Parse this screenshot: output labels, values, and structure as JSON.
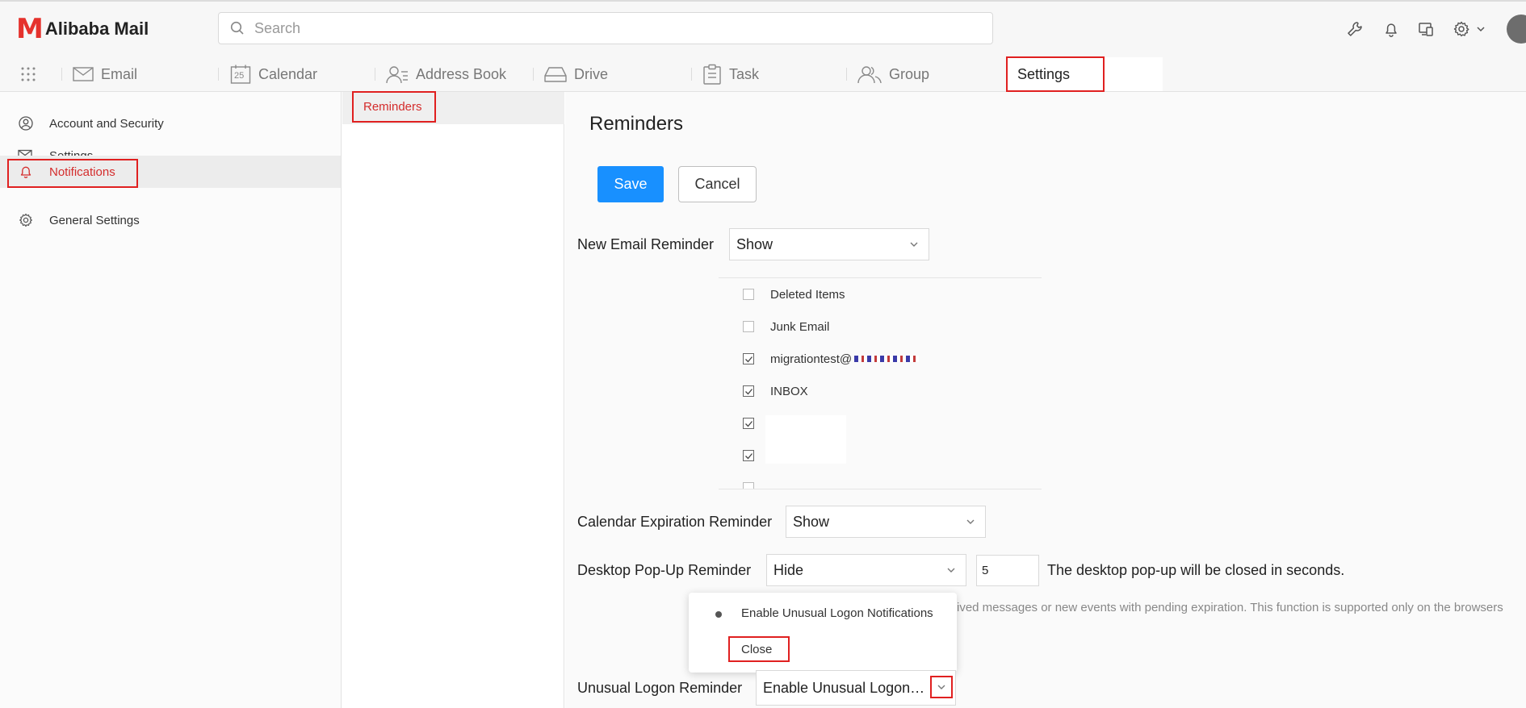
{
  "app": {
    "logo_mark": "M",
    "logo_text": "Alibaba Mail"
  },
  "search": {
    "placeholder": "Search"
  },
  "top_icons": [
    "wrench-icon",
    "bell-icon",
    "devices-icon",
    "gear-icon"
  ],
  "nav": {
    "tabs": [
      {
        "label": "Email",
        "icon": "envelope-icon"
      },
      {
        "label": "Calendar",
        "icon": "calendar-icon"
      },
      {
        "label": "Address Book",
        "icon": "contacts-icon"
      },
      {
        "label": "Drive",
        "icon": "drive-icon"
      },
      {
        "label": "Task",
        "icon": "clipboard-icon"
      },
      {
        "label": "Group",
        "icon": "group-icon"
      },
      {
        "label": "Settings",
        "icon": ""
      }
    ],
    "calendar_day": "25",
    "active_tab": "Settings"
  },
  "sidebar": {
    "items": [
      {
        "label": "Account and Security",
        "icon": "user-circle-icon"
      },
      {
        "label": "Settings",
        "icon": "mail-settings-icon"
      },
      {
        "label": "Notifications",
        "icon": "bell-icon"
      },
      {
        "label": "General Settings",
        "icon": "gear-icon"
      }
    ],
    "active": "Notifications"
  },
  "subnav": {
    "items": [
      {
        "label": "Reminders"
      }
    ]
  },
  "main": {
    "title": "Reminders",
    "save_label": "Save",
    "cancel_label": "Cancel",
    "new_email": {
      "label": "New Email Reminder",
      "value": "Show",
      "folders": [
        {
          "label": "Deleted Items",
          "checked": false
        },
        {
          "label": "Junk Email",
          "checked": false
        },
        {
          "label": "migrationtest@",
          "checked": true
        },
        {
          "label": "INBOX",
          "checked": true
        },
        {
          "label": "",
          "checked": true
        },
        {
          "label": "",
          "checked": true
        },
        {
          "label": "",
          "checked": false
        }
      ]
    },
    "calendar_expiration": {
      "label": "Calendar Expiration Reminder",
      "value": "Show"
    },
    "desktop_popup": {
      "label": "Desktop Pop-Up Reminder",
      "value": "Hide",
      "seconds": "5",
      "note": "The desktop pop-up will be closed in seconds.",
      "hint": "rived messages or new events with pending expiration. This function is supported only on the browsers"
    },
    "unusual_logon": {
      "label": "Unusual Logon Reminder",
      "value": "Enable Unusual Logon Notifications",
      "dropdown_options": [
        "Enable Unusual Logon Notifications",
        "Close"
      ]
    }
  },
  "colors": {
    "brand_red": "#e5322d",
    "primary_blue": "#1890ff",
    "highlight_red": "#e02020"
  }
}
